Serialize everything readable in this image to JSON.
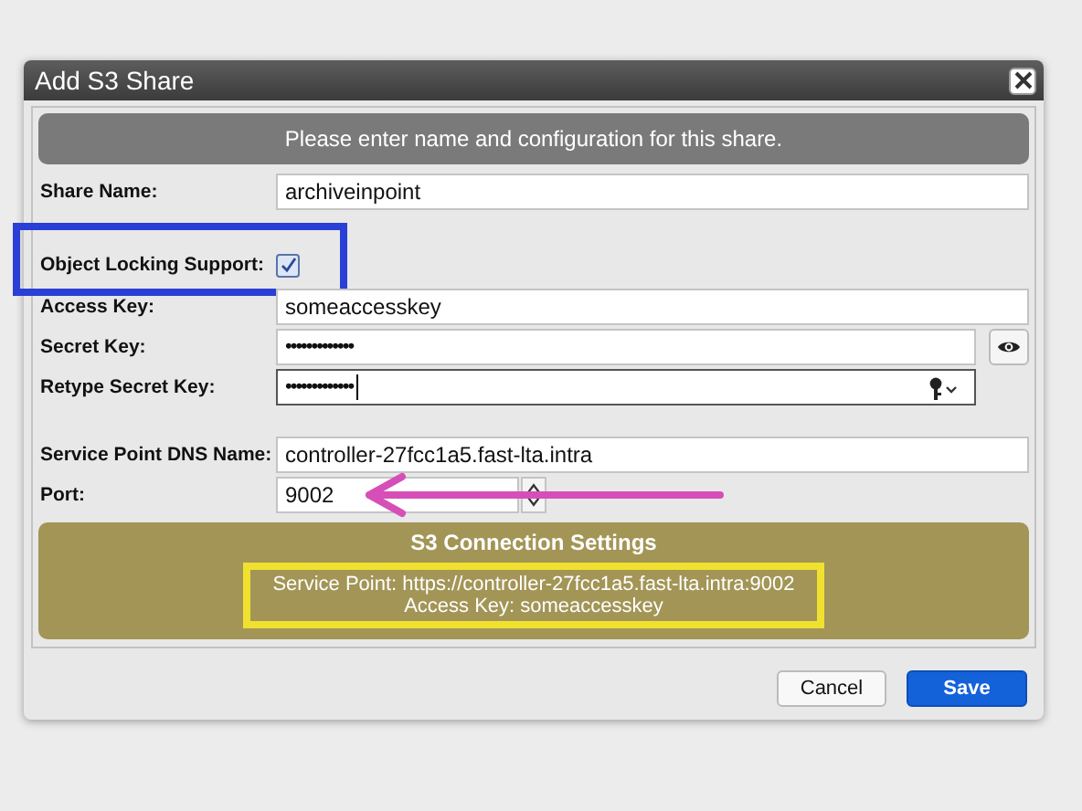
{
  "window": {
    "title": "Add S3 Share"
  },
  "header": "Please enter name and configuration for this share.",
  "fields": [
    {
      "kind": "text",
      "label": "Share Name:",
      "value": "archiveinpoint"
    },
    {
      "kind": "checkbox",
      "label": "Object Locking Support:",
      "checked": true,
      "highlighted": true
    },
    {
      "kind": "text",
      "label": "Access Key:",
      "value": "someaccesskey"
    },
    {
      "kind": "password",
      "label": "Secret Key:",
      "value": "•••••••••••••",
      "reveal": true
    },
    {
      "kind": "password",
      "label": "Retype Secret Key:",
      "value": "•••••••••••••",
      "focused": true,
      "keychain": true
    },
    {
      "kind": "text",
      "label": "Service Point DNS Name:",
      "value": "controller-27fcc1a5.fast-lta.intra",
      "spaced": true
    },
    {
      "kind": "number",
      "label": "Port:",
      "value": "9002",
      "arrow": true
    }
  ],
  "connection": {
    "title": "S3 Connection Settings",
    "lines": [
      "Service Point: https://controller-27fcc1a5.fast-lta.intra:9002",
      "Access Key: someaccesskey"
    ],
    "highlighted": true
  },
  "buttons": [
    {
      "label": "Cancel",
      "kind": "secondary"
    },
    {
      "label": "Save",
      "kind": "primary"
    }
  ]
}
